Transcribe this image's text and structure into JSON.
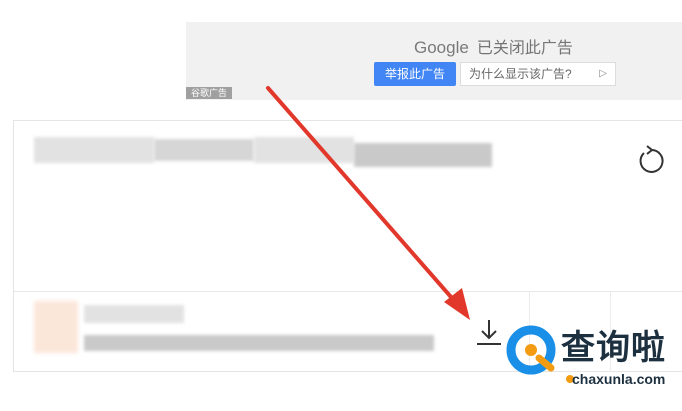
{
  "ad": {
    "brand": "Google",
    "closed_text": "已关闭此广告",
    "report_label": "举报此广告",
    "why_label": "为什么显示该广告?",
    "tag": "谷歌广告"
  },
  "icons": {
    "refresh": "refresh-icon",
    "download": "download-icon",
    "arrow": "red-arrow-annotation"
  },
  "colors": {
    "report_button": "#4285f4",
    "arrow": "#e2382c",
    "watermark_blue": "#1a8fe8",
    "watermark_orange": "#f39c12"
  },
  "watermark": {
    "name": "查询啦",
    "domain": "chaxunla.com"
  }
}
